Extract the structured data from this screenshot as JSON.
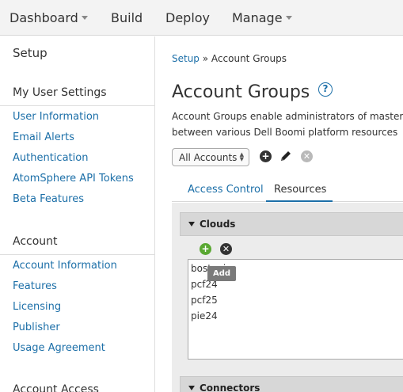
{
  "topnav": {
    "items": [
      {
        "label": "Dashboard",
        "has_caret": true
      },
      {
        "label": "Build",
        "has_caret": false
      },
      {
        "label": "Deploy",
        "has_caret": false
      },
      {
        "label": "Manage",
        "has_caret": true
      }
    ]
  },
  "sidebar": {
    "title": "Setup",
    "sections": [
      {
        "heading": "My User Settings",
        "links": [
          "User Information",
          "Email Alerts",
          "Authentication",
          "AtomSphere API Tokens",
          "Beta Features"
        ]
      },
      {
        "heading": "Account",
        "links": [
          "Account Information",
          "Features",
          "Licensing",
          "Publisher",
          "Usage Agreement"
        ]
      },
      {
        "heading": "Account Access",
        "links": []
      }
    ]
  },
  "main": {
    "breadcrumb": {
      "parent": "Setup",
      "separator": " » ",
      "current": "Account Groups"
    },
    "title": "Account Groups",
    "help_icon": "?",
    "description_lines": [
      "Account Groups enable administrators of master",
      "between various Dell Boomi platform resources"
    ],
    "account_select": {
      "selected": "All Accounts"
    },
    "toolbar_icons": [
      "add-icon",
      "edit-pencil-icon",
      "delete-icon"
    ],
    "tabs": [
      {
        "label": "Access Control",
        "active": false
      },
      {
        "label": "Resources",
        "active": true
      }
    ],
    "clouds": {
      "header": "Clouds",
      "items": [
        "bostoni",
        "pcf24",
        "pcf25",
        "pie24"
      ],
      "tooltip": "Add"
    },
    "connectors": {
      "header": "Connectors"
    }
  },
  "colors": {
    "link": "#1c6fa8",
    "add_green": "#5aa832",
    "remove_dark": "#333333",
    "delete_gray": "#b9b9b9"
  }
}
